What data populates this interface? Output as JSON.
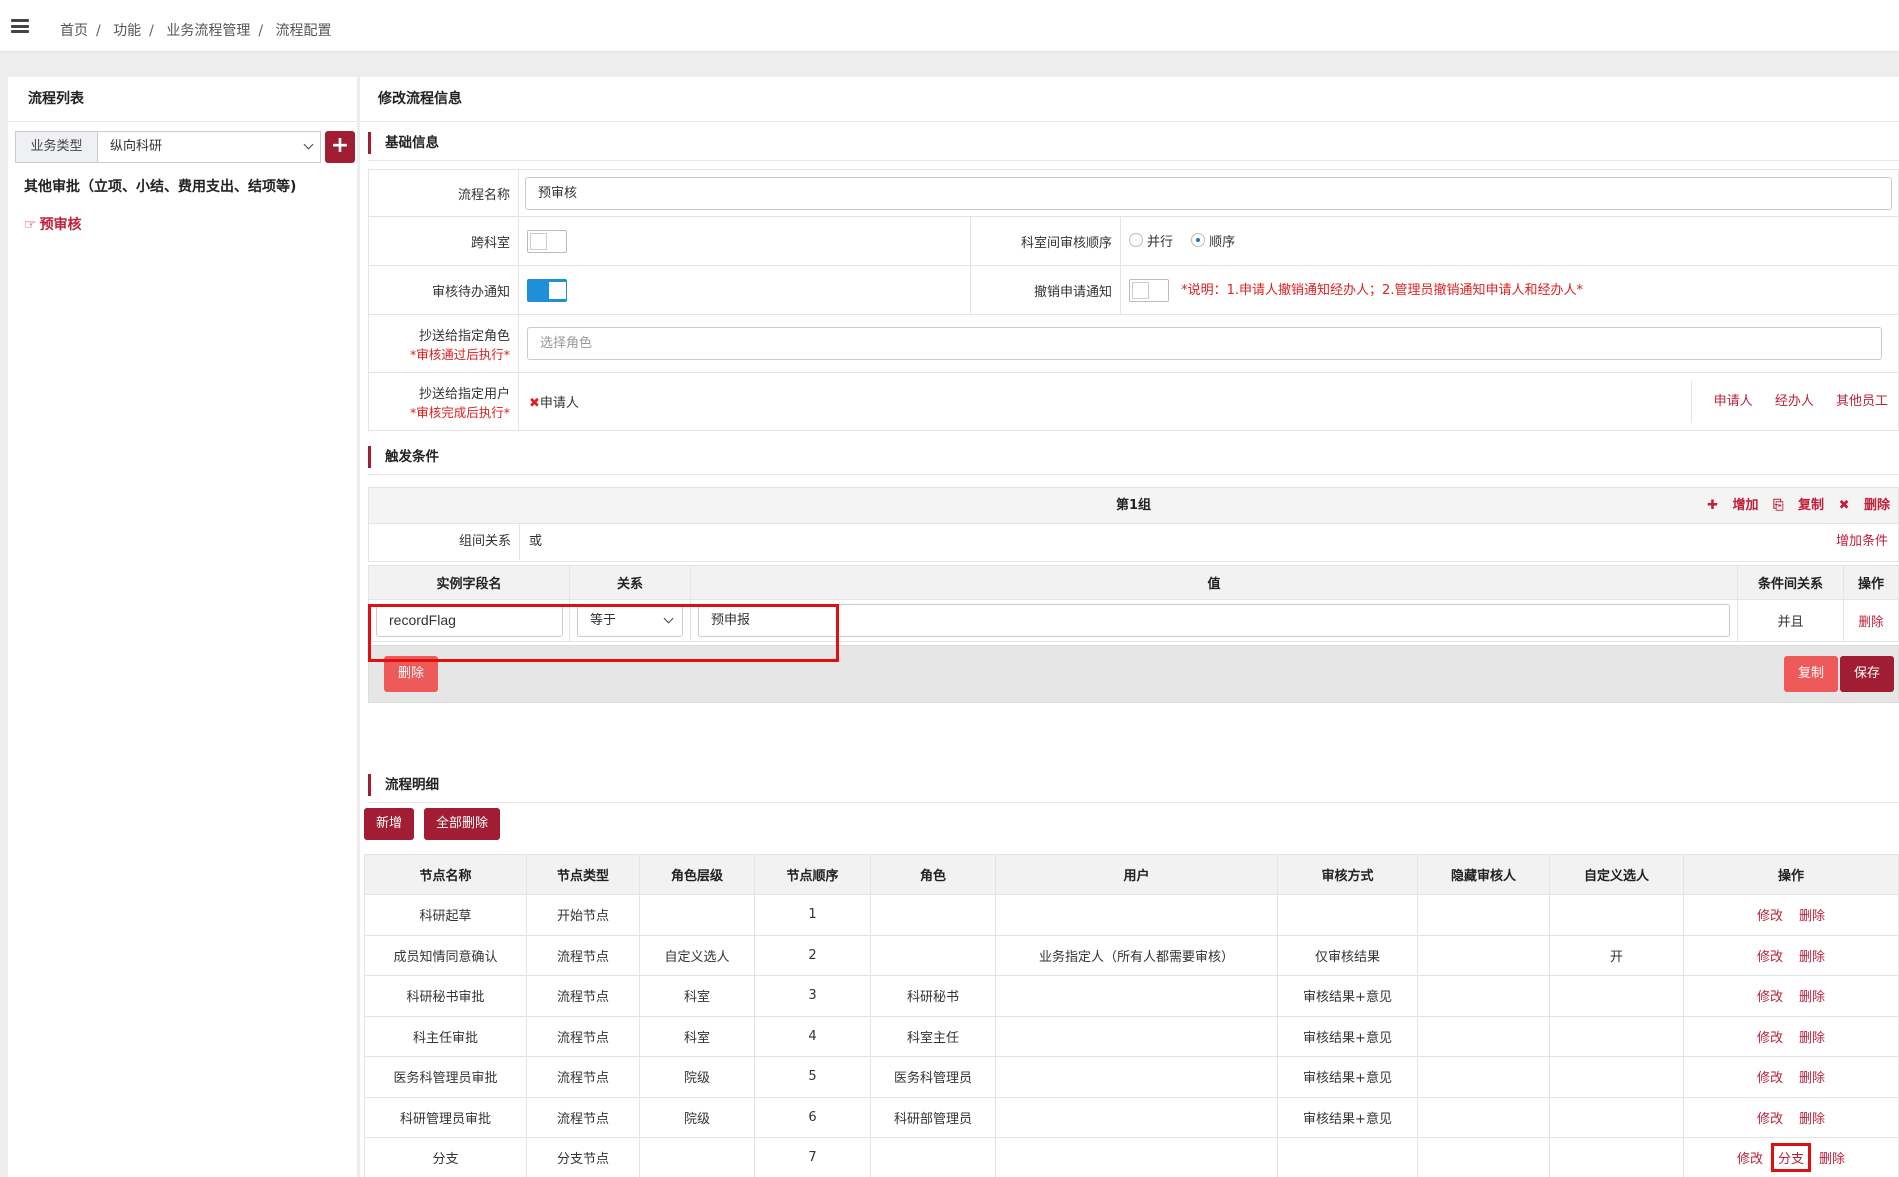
{
  "breadcrumb": [
    "首页",
    "功能",
    "业务流程管理",
    "流程配置"
  ],
  "left": {
    "title": "流程列表",
    "biz_label": "业务类型",
    "biz_value": "纵向科研",
    "add_symbol": "+",
    "group_title": "其他审批（立项、小结、费用支出、结项等)",
    "flow_item": "预审核"
  },
  "right": {
    "title": "修改流程信息",
    "basic_title": "基础信息",
    "flow_name_label": "流程名称",
    "flow_name_value": "预审核",
    "cross_label": "跨科室",
    "order_label": "科室间审核顺序",
    "order_parallel": "并行",
    "order_sequence": "顺序",
    "notify_label": "审核待办通知",
    "cancel_label": "撤销申请通知",
    "cancel_note": "*说明：1.申请人撤销通知经办人；2.管理员撤销通知申请人和经办人*",
    "cc_role_label": "抄送给指定角色",
    "cc_role_req": "*审核通过后执行*",
    "cc_role_placeholder": "选择角色",
    "cc_user_label": "抄送给指定用户",
    "cc_user_req": "*审核完成后执行*",
    "cc_user_tag": "申请人",
    "cc_user_links": [
      "申请人",
      "经办人",
      "其他员工"
    ]
  },
  "trigger": {
    "title": "触发条件",
    "group_name": "第1组",
    "group_actions": {
      "add": "增加",
      "copy": "复制",
      "delete": "删除"
    },
    "relation_label": "组间关系",
    "relation_value": "或",
    "add_condition": "增加条件",
    "columns": [
      "实例字段名",
      "关系",
      "值",
      "条件间关系",
      "操作"
    ],
    "row": {
      "field": "recordFlag",
      "op": "等于",
      "value": "预申报",
      "logic": "并且",
      "action": "删除"
    },
    "delete_btn": "删除",
    "copy_btn": "复制",
    "save_btn": "保存"
  },
  "details": {
    "title": "流程明细",
    "add_btn": "新增",
    "delete_all_btn": "全部删除",
    "columns": [
      "节点名称",
      "节点类型",
      "角色层级",
      "节点顺序",
      "角色",
      "用户",
      "审核方式",
      "隐藏审核人",
      "自定义选人",
      "操作"
    ],
    "rows": [
      [
        "科研起草",
        "开始节点",
        "",
        "1",
        "",
        "",
        "",
        "",
        ""
      ],
      [
        "成员知情同意确认",
        "流程节点",
        "自定义选人",
        "2",
        "",
        "业务指定人（所有人都需要审核）",
        "仅审核结果",
        "",
        "开"
      ],
      [
        "科研秘书审批",
        "流程节点",
        "科室",
        "3",
        "科研秘书",
        "",
        "审核结果+意见",
        "",
        ""
      ],
      [
        "科主任审批",
        "流程节点",
        "科室",
        "4",
        "科室主任",
        "",
        "审核结果+意见",
        "",
        ""
      ],
      [
        "医务科管理员审批",
        "流程节点",
        "院级",
        "5",
        "医务科管理员",
        "",
        "审核结果+意见",
        "",
        ""
      ],
      [
        "科研管理员审批",
        "流程节点",
        "院级",
        "6",
        "科研部管理员",
        "",
        "审核结果+意见",
        "",
        ""
      ],
      [
        "分支",
        "分支节点",
        "",
        "7",
        "",
        "",
        "",
        "",
        ""
      ]
    ],
    "op_edit": "修改",
    "op_delete": "删除",
    "op_branch": "分支"
  }
}
